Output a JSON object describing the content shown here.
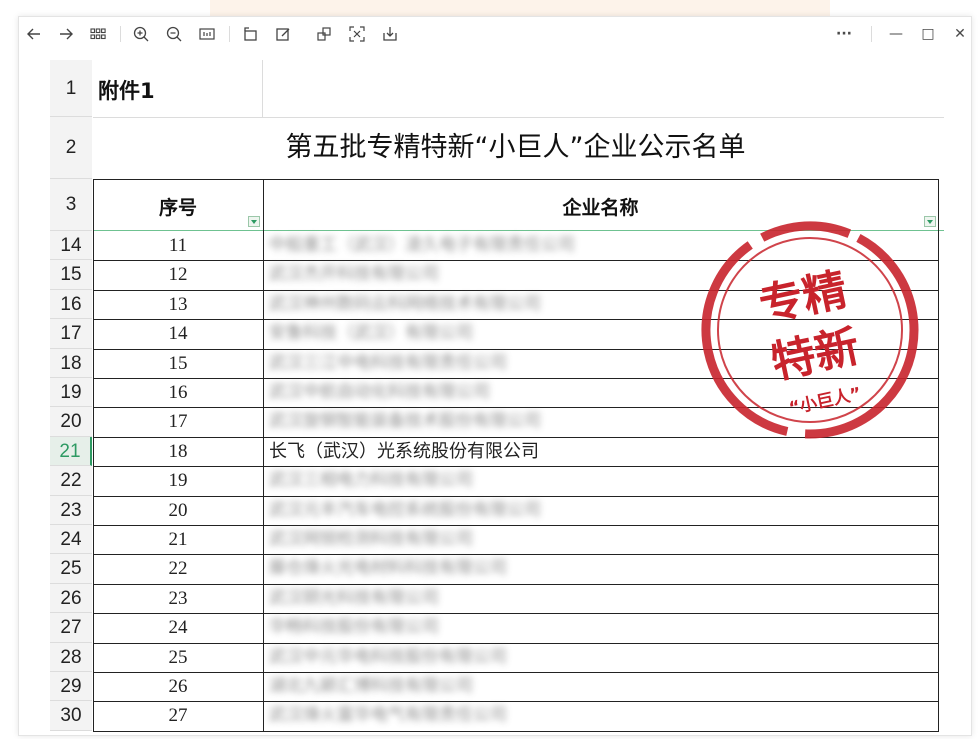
{
  "toolbar": {
    "more_label": "···",
    "minimize_label": "—",
    "maximize_label": "□",
    "close_label": "✕"
  },
  "sheet": {
    "attachment": "附件1",
    "title": "第五批专精特新“小巨人”企业公示名单",
    "col_seq": "序号",
    "col_name": "企业名称",
    "header_rows": [
      "1",
      "2",
      "3"
    ],
    "active_row": "21",
    "rows": [
      {
        "rn": "14",
        "seq": "11",
        "name": "中船重工（武汉）凌久电子有限责任公司",
        "blurred": true
      },
      {
        "rn": "15",
        "seq": "12",
        "name": "武汉杰开科技有限公司",
        "blurred": true
      },
      {
        "rn": "16",
        "seq": "13",
        "name": "武汉神州数码云科网络技术有限公司",
        "blurred": true
      },
      {
        "rn": "17",
        "seq": "14",
        "name": "安鲁科技（武汉）有限公司",
        "blurred": true
      },
      {
        "rn": "18",
        "seq": "15",
        "name": "武汉三江中电科技有限责任公司",
        "blurred": true
      },
      {
        "rn": "19",
        "seq": "16",
        "name": "武汉中航自动化科技有限公司",
        "blurred": true
      },
      {
        "rn": "20",
        "seq": "17",
        "name": "武汉旋钢智能装备技术股份有限公司",
        "blurred": true
      },
      {
        "rn": "21",
        "seq": "18",
        "name": "长飞（武汉）光系统股份有限公司",
        "blurred": false
      },
      {
        "rn": "22",
        "seq": "19",
        "name": "武汉三相电力科技有限公司",
        "blurred": true
      },
      {
        "rn": "23",
        "seq": "20",
        "name": "武汉元丰汽车电控系统股份有限公司",
        "blurred": true
      },
      {
        "rn": "24",
        "seq": "21",
        "name": "武汉网锐检测科技有限公司",
        "blurred": true
      },
      {
        "rn": "25",
        "seq": "22",
        "name": "藤仓烽火光电材料科技有限公司",
        "blurred": true
      },
      {
        "rn": "26",
        "seq": "23",
        "name": "武汉颐光科技有限公司",
        "blurred": true
      },
      {
        "rn": "27",
        "seq": "24",
        "name": "华畅科技股份有限公司",
        "blurred": true
      },
      {
        "rn": "28",
        "seq": "25",
        "name": "武汉中元华电科技股份有限公司",
        "blurred": true
      },
      {
        "rn": "29",
        "seq": "26",
        "name": "湖北九颖汇博科技有限公司",
        "blurred": true
      },
      {
        "rn": "30",
        "seq": "27",
        "name": "武汉烽火富华电气有限责任公司",
        "blurred": true
      }
    ]
  },
  "stamp": {
    "line1": "专精",
    "line2": "特新",
    "bottom": "“小巨人”",
    "color": "#c8232c"
  },
  "colors": {
    "accent": "#2e9a63",
    "grid": "#222222",
    "header_bg": "#f3f3f3"
  }
}
